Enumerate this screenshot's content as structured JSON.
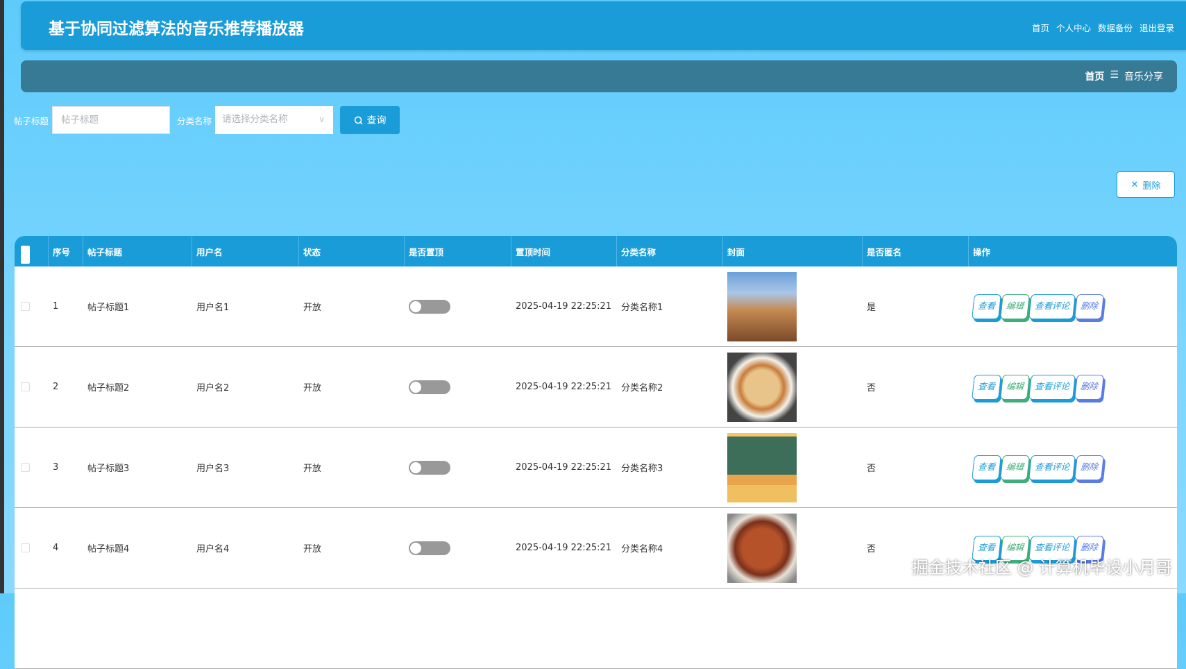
{
  "app": {
    "title": "基于协同过滤算法的音乐推荐播放器",
    "nav": [
      "首页",
      "个人中心",
      "数据备份",
      "退出登录"
    ]
  },
  "breadcrumb": {
    "home": "首页",
    "separator": "☰",
    "current": "音乐分享"
  },
  "search": {
    "title_label": "帖子标题",
    "title_placeholder": "帖子标题",
    "category_label": "分类名称",
    "category_placeholder": "请选择分类名称",
    "query_button": "查询"
  },
  "toolbar": {
    "delete_label": "删除"
  },
  "table": {
    "columns": [
      "序号",
      "帖子标题",
      "用户名",
      "状态",
      "是否置顶",
      "置顶时间",
      "分类名称",
      "封面",
      "是否匿名",
      "操作"
    ],
    "actions": [
      "查看",
      "编辑",
      "查看评论",
      "删除"
    ],
    "rows": [
      {
        "index": "1",
        "title": "帖子标题1",
        "user": "用户名1",
        "status": "开放",
        "pinned": false,
        "pin_time": "2025-04-19 22:25:21",
        "category": "分类名称1",
        "cover": "city",
        "anonymous": "是"
      },
      {
        "index": "2",
        "title": "帖子标题2",
        "user": "用户名2",
        "status": "开放",
        "pinned": false,
        "pin_time": "2025-04-19 22:25:21",
        "category": "分类名称2",
        "cover": "noodles",
        "anonymous": "否"
      },
      {
        "index": "3",
        "title": "帖子标题3",
        "user": "用户名3",
        "status": "开放",
        "pinned": false,
        "pin_time": "2025-04-19 22:25:21",
        "category": "分类名称3",
        "cover": "classroom",
        "anonymous": "否"
      },
      {
        "index": "4",
        "title": "帖子标题4",
        "user": "用户名4",
        "status": "开放",
        "pinned": false,
        "pin_time": "2025-04-19 22:25:21",
        "category": "分类名称4",
        "cover": "dish",
        "anonymous": "否"
      }
    ]
  },
  "watermark": "掘金技术社区 @ 计算机毕设小月哥",
  "colors": {
    "primary": "#1a9cd8",
    "breadcrumb_bg": "#367a96",
    "edit": "#3fae7a",
    "delete": "#5b7be8"
  }
}
